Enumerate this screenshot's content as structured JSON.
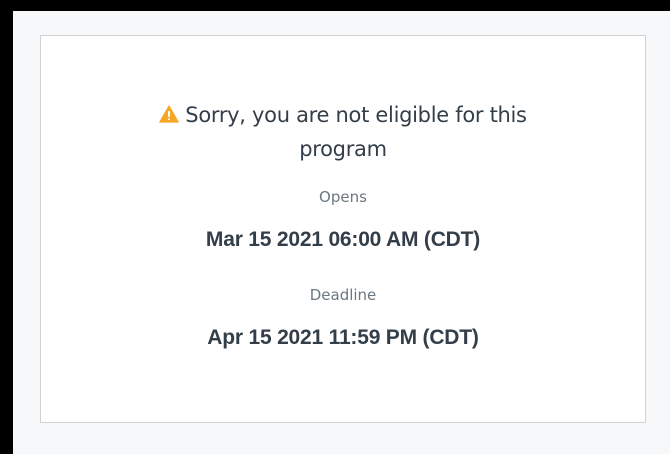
{
  "eligibility": {
    "message_line1": "Sorry, you are not eligible for this",
    "message_line2": "program",
    "icon": "warning-icon",
    "icon_color": "#f5a623"
  },
  "opens": {
    "label": "Opens",
    "value": "Mar 15 2021 06:00 AM (CDT)"
  },
  "deadline": {
    "label": "Deadline",
    "value": "Apr 15 2021 11:59 PM (CDT)"
  }
}
